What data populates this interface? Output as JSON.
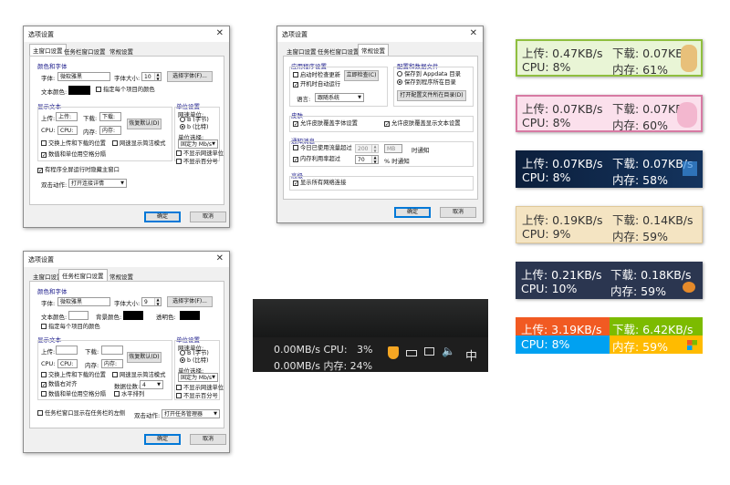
{
  "dialog_common": {
    "title": "选项设置",
    "ok": "确定",
    "cancel": "取消",
    "tabs": [
      "主窗口设置",
      "任务栏窗口设置",
      "常规设置"
    ]
  },
  "main_window": {
    "color_font_section": "颜色和字体",
    "font_label": "字体:",
    "font_value": "微软雅黑",
    "font_size_label": "字体大小:",
    "font_size_value": "10",
    "choose_font_button": "选择字体(F)...",
    "text_color_label": "文本颜色:",
    "specify_each_color": "指定每个项目的颜色",
    "display_text_section": "显示文本",
    "upload_label": "上传:",
    "upload_value": "上传:",
    "download_label": "下载:",
    "download_value": "下载:",
    "restore_default": "恢复默认(D)",
    "cpu_label": "CPU:",
    "cpu_value": "CPU:",
    "memory_label": "内存:",
    "memory_value": "内存:",
    "swap_up_down": "交换上传和下载的位置",
    "simple_mode": "网速显示简洁模式",
    "unit_space": "数值和单位用空格分隔",
    "unit_section": "单位设置",
    "speed_unit": "网速单位:",
    "unit_B": "B (字节)",
    "unit_b": "b (比特)",
    "unit_select": "单位选择:",
    "unit_select_value": "固定为 Mb/s",
    "no_speed_unit": "不显示网速单位",
    "no_percent": "不显示百分号",
    "hide_fullscreen": "有程序全屏运行时隐藏主窗口",
    "double_click_label": "双击动作:",
    "double_click_value": "打开连接详情"
  },
  "general": {
    "app_section": "应用程序设置",
    "auto_update": "启动时检查更新",
    "check_now": "立即检查(C)",
    "auto_start": "开机时自动运行",
    "language_label": "语言:",
    "language_value": "跟随系统",
    "config_section": "配置和数据文件",
    "save_appdata": "保存到 Appdata 目录",
    "save_program": "保存到程序所在目录",
    "open_config": "打开配置文件所在目录(D)",
    "skin_section": "皮肤",
    "skin_font": "允许皮肤覆盖字体设置",
    "skin_text": "允许皮肤覆盖显示文本设置",
    "notify_section": "通知消息",
    "traffic_label": "今日已使用流量超过",
    "traffic_value": "200",
    "traffic_unit": "MB",
    "notify_when": "时通知",
    "memory_usage": "内存利用率超过",
    "memory_value": "70",
    "percent_notify": "% 时通知",
    "advanced_section": "高级",
    "show_all_connections": "显示所有网络连接"
  },
  "taskbar_window": {
    "color_font_section": "颜色和字体",
    "font_label": "字体:",
    "font_value": "微软雅黑",
    "font_size_label": "字体大小:",
    "font_size_value": "9",
    "choose_font_button": "选择字体(F)...",
    "text_color_label": "文本颜色:",
    "bg_color_label": "背景颜色:",
    "transparent_label": "透明色:",
    "specify_each_color": "指定每个项目的颜色",
    "display_text_section": "显示文本",
    "upload_label": "上传:",
    "download_label": "下载:",
    "restore_default": "恢复默认(D)",
    "cpu_label": "CPU:",
    "cpu_value": "CPU:",
    "memory_label": "内存:",
    "memory_value": "内存:",
    "swap_up_down": "交换上传和下载的位置",
    "simple_mode": "网速显示简洁模式",
    "right_align": "数值右对齐",
    "digits_label": "数据位数:",
    "digits_value": "4",
    "unit_space": "数值和单位用空格分隔",
    "horizontal": "水平排列",
    "unit_section": "单位设置",
    "speed_unit": "网速单位:",
    "unit_B": "B (字节)",
    "unit_b": "b (比特)",
    "unit_select": "单位选择:",
    "unit_select_value": "固定为 Mb/s",
    "no_speed_unit": "不显示网速单位",
    "no_percent": "不显示百分号",
    "left_of_taskbar": "任务栏窗口显示在任务栏的左侧",
    "double_click_label": "双击动作:",
    "double_click_value": "打开任务管理器"
  },
  "taskbar_preview": {
    "row1": "0.00MB/s CPU:   3%",
    "row2": "0.00MB/s 内存: 24%",
    "ime": "中"
  },
  "skins": [
    {
      "up": "上传: 0.47KB/s",
      "down": "下载: 0.07KB/s",
      "cpu": "CPU: 8%",
      "mem": "内存: 61%",
      "bg": "#e9f5d6",
      "border": "#8fbf3f",
      "fg": "#333333"
    },
    {
      "up": "上传: 0.07KB/s",
      "down": "下载: 0.07KB/s",
      "cpu": "CPU: 8%",
      "mem": "内存: 60%",
      "bg": "#fbe0ec",
      "border": "#d77aa3",
      "fg": "#333333"
    },
    {
      "up": "上传: 0.07KB/s",
      "down": "下载: 0.07KB/s",
      "cpu": "CPU: 8%",
      "mem": "内存: 58%",
      "bg": "#0f2647",
      "border": "#0f2647",
      "fg": "#ffffff"
    },
    {
      "up": "上传: 0.19KB/s",
      "down": "下载: 0.14KB/s",
      "cpu": "CPU: 9%",
      "mem": "内存: 59%",
      "bg": "#f4e4c2",
      "border": "#e0c898",
      "fg": "#333333"
    },
    {
      "up": "上传: 0.21KB/s",
      "down": "下载: 0.18KB/s",
      "cpu": "CPU: 10%",
      "mem": "内存: 59%",
      "bg": "#2b3650",
      "border": "#2b3650",
      "fg": "#ffffff"
    },
    {
      "up": "上传: 3.19KB/s",
      "down": "下载: 6.42KB/s",
      "cpu": "CPU: 8%",
      "mem": "内存: 59%",
      "colors": [
        "#f15a22",
        "#7cbb00",
        "#00a1f1",
        "#ffbb00"
      ],
      "fg": "#ffffff"
    }
  ]
}
